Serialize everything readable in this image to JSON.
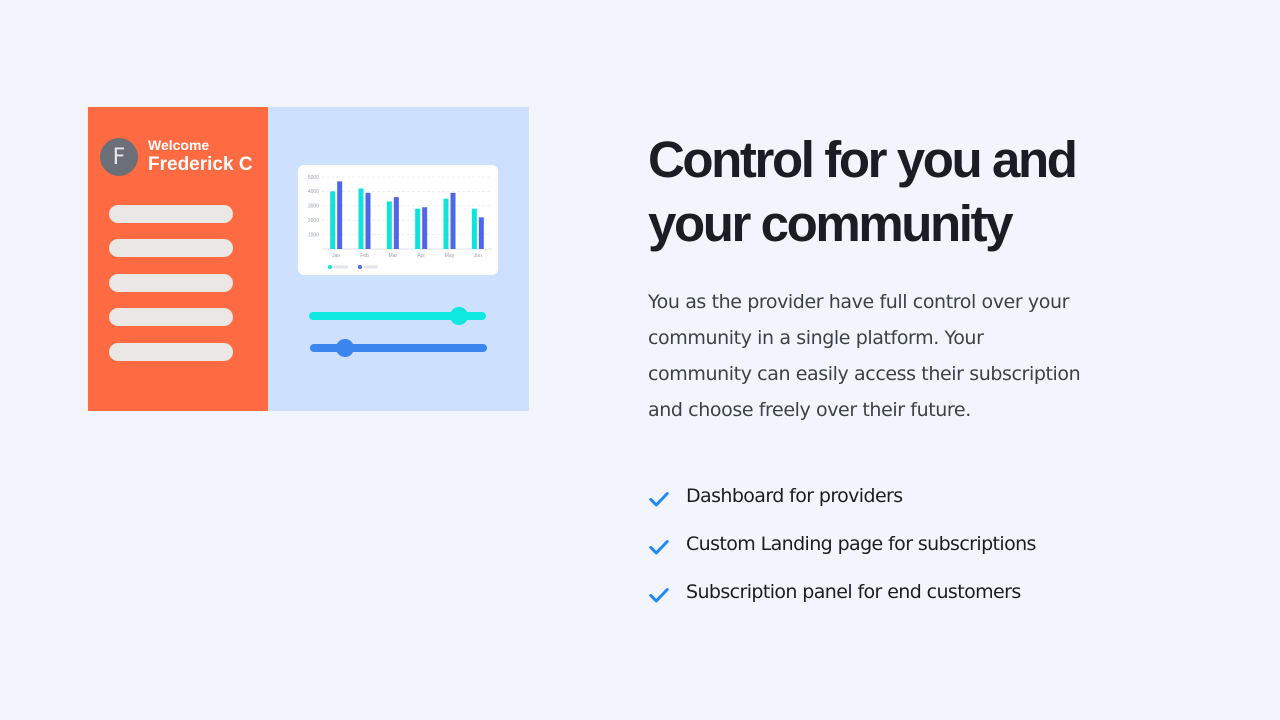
{
  "illustration": {
    "avatar_letter": "F",
    "welcome_label": "Welcome",
    "user_name": "Frederick C",
    "sidebar_items": 5,
    "chart_data": {
      "type": "bar",
      "categories": [
        "Jan",
        "Feb",
        "Mar",
        "Apr",
        "May",
        "Jun"
      ],
      "series": [
        {
          "name": "",
          "values": [
            4000,
            4200,
            3300,
            2800,
            3500,
            2800
          ],
          "color": "#0fe3dc"
        },
        {
          "name": "",
          "values": [
            4700,
            3900,
            3600,
            2900,
            3900,
            2200
          ],
          "color": "#4f66e8"
        }
      ],
      "yticks": [
        "5000",
        "4000",
        "3000",
        "2000",
        "1000"
      ],
      "ylim": [
        0,
        5000
      ]
    },
    "sliders": [
      {
        "value": 0.85,
        "color": "#0fe8e0"
      },
      {
        "value": 0.2,
        "color": "#3a86ee"
      }
    ],
    "colors": {
      "sidebar": "#fe6a41",
      "panel": "#cde0fe"
    }
  },
  "heading": {
    "line1": "Control for you and",
    "line2": "your community"
  },
  "description": "You as the provider have full control over your community in a single platform. Your community can easily access their subscription and choose freely over their future.",
  "features": [
    {
      "icon": "check-icon",
      "label": "Dashboard for providers"
    },
    {
      "icon": "check-icon",
      "label": "Custom Landing page for subscriptions"
    },
    {
      "icon": "check-icon",
      "label": "Subscription panel for end customers"
    }
  ],
  "accent_color": "#1e88ff"
}
